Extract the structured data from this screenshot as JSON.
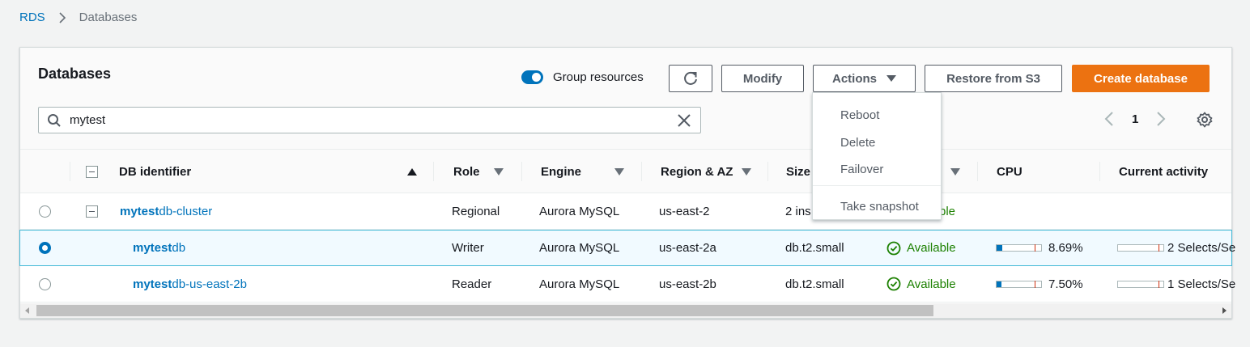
{
  "breadcrumb": {
    "root": "RDS",
    "current": "Databases"
  },
  "header": {
    "title": "Databases",
    "group_resources_label": "Group resources",
    "group_resources_on": true,
    "modify_label": "Modify",
    "actions_label": "Actions",
    "restore_label": "Restore from S3",
    "create_label": "Create database"
  },
  "search": {
    "value": "mytest"
  },
  "pagination": {
    "page": "1"
  },
  "columns": {
    "db_identifier": "DB identifier",
    "role": "Role",
    "engine": "Engine",
    "region": "Region & AZ",
    "size": "Size",
    "cpu": "CPU",
    "activity": "Current activity"
  },
  "rows": [
    {
      "id_match": "mytest",
      "id_rest": "db-cluster",
      "role": "Regional",
      "engine": "Aurora MySQL",
      "region": "us-east-2",
      "size": "2 ins",
      "status": "ble",
      "selected": false
    },
    {
      "id_match": "mytest",
      "id_rest": "db",
      "role": "Writer",
      "engine": "Aurora MySQL",
      "region": "us-east-2a",
      "size": "db.t2.small",
      "status": "Available",
      "cpu": "8.69%",
      "cpu_fraction": 0.0869,
      "activity": "2 Selects/Se",
      "selected": true
    },
    {
      "id_match": "mytest",
      "id_rest": "db-us-east-2b",
      "role": "Reader",
      "engine": "Aurora MySQL",
      "region": "us-east-2b",
      "size": "db.t2.small",
      "status": "Available",
      "cpu": "7.50%",
      "cpu_fraction": 0.075,
      "activity": "1 Selects/Se",
      "selected": false
    }
  ],
  "actions_menu": [
    "Reboot",
    "Delete",
    "Failover",
    "Take snapshot"
  ],
  "colors": {
    "accent": "#0073bb",
    "primary_button": "#ec7211",
    "success": "#1d8102"
  }
}
